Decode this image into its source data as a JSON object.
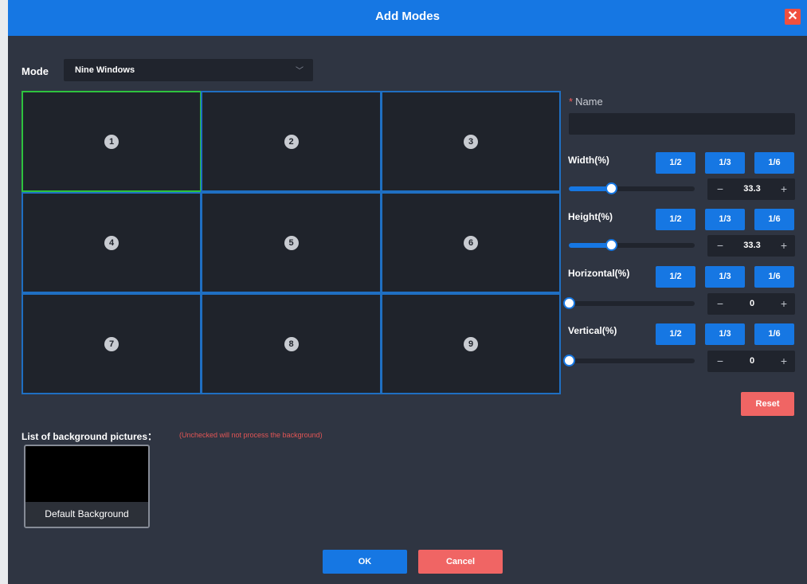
{
  "dialog": {
    "title": "Add Modes",
    "close_icon": "close-icon",
    "colors": {
      "titlebar": "#1677e3",
      "body": "#2f3542",
      "primary": "#1677e3",
      "danger": "#f06564",
      "selected_border": "#2ec23e",
      "cell_border": "#1f6fc2"
    }
  },
  "mode": {
    "label": "Mode",
    "value": "Nine Windows",
    "chevron_icon": "chevron-down-icon"
  },
  "grid": {
    "cells": [
      {
        "number": "1"
      },
      {
        "number": "2"
      },
      {
        "number": "3"
      },
      {
        "number": "4"
      },
      {
        "number": "5"
      },
      {
        "number": "6"
      },
      {
        "number": "7"
      },
      {
        "number": "8"
      },
      {
        "number": "9"
      }
    ],
    "selected_index": 0
  },
  "name_field": {
    "required_mark": "*",
    "label": "Name",
    "value": ""
  },
  "controls": {
    "fractions": [
      "1/2",
      "1/3",
      "1/6"
    ],
    "width": {
      "label": "Width(%)",
      "value": "33.3",
      "slider_percent": 33.3
    },
    "height": {
      "label": "Height(%)",
      "value": "33.3",
      "slider_percent": 33.3
    },
    "horizontal": {
      "label": "Horizontal(%)",
      "value": "0",
      "slider_percent": 0
    },
    "vertical": {
      "label": "Vertical(%)",
      "value": "0",
      "slider_percent": 0
    },
    "minus": "−",
    "plus": "+"
  },
  "reset_label": "Reset",
  "background": {
    "label": "List of background pictures：",
    "note": "(Unchecked will not process the background)",
    "items": [
      {
        "caption": "Default Background"
      }
    ]
  },
  "footer": {
    "ok_label": "OK",
    "cancel_label": "Cancel"
  }
}
